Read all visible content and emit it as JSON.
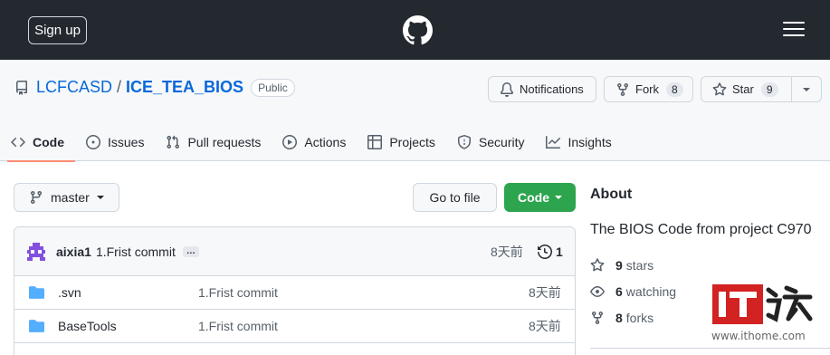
{
  "header": {
    "signup_label": "Sign up",
    "logo_icon": "github-mark-icon",
    "menu_icon": "hamburger-menu-icon"
  },
  "repo": {
    "owner": "LCFCASD",
    "separator": "/",
    "name": "ICE_TEA_BIOS",
    "visibility": "Public",
    "notifications_label": "Notifications",
    "fork_label": "Fork",
    "fork_count": "8",
    "star_label": "Star",
    "star_count": "9"
  },
  "tabs": [
    {
      "label": "Code",
      "icon": "code-icon",
      "active": true
    },
    {
      "label": "Issues",
      "icon": "issue-opened-icon"
    },
    {
      "label": "Pull requests",
      "icon": "git-pull-request-icon"
    },
    {
      "label": "Actions",
      "icon": "play-icon"
    },
    {
      "label": "Projects",
      "icon": "table-icon"
    },
    {
      "label": "Security",
      "icon": "shield-icon"
    },
    {
      "label": "Insights",
      "icon": "graph-icon"
    }
  ],
  "toolbar": {
    "branch": "master",
    "goto_file_label": "Go to file",
    "code_label": "Code"
  },
  "latest_commit": {
    "author": "aixia1",
    "message": "1.Frist commit",
    "ellipsis": "…",
    "time": "8天前",
    "commit_count": "1"
  },
  "files": [
    {
      "name": ".svn",
      "message": "1.Frist commit",
      "time": "8天前"
    },
    {
      "name": "BaseTools",
      "message": "1.Frist commit",
      "time": "8天前"
    }
  ],
  "about": {
    "heading": "About",
    "description": "The BIOS Code from project C970",
    "stars_count": "9",
    "stars_label": "stars",
    "watching_count": "6",
    "watching_label": "watching",
    "forks_count": "8",
    "forks_label": "forks"
  },
  "watermark": {
    "url": "www.ithome.com"
  },
  "colors": {
    "header_bg": "#24292f",
    "link_blue": "#0969da",
    "code_button_green": "#2da44e",
    "active_tab_underline": "#fd8c73",
    "watermark_red": "#d22222"
  }
}
